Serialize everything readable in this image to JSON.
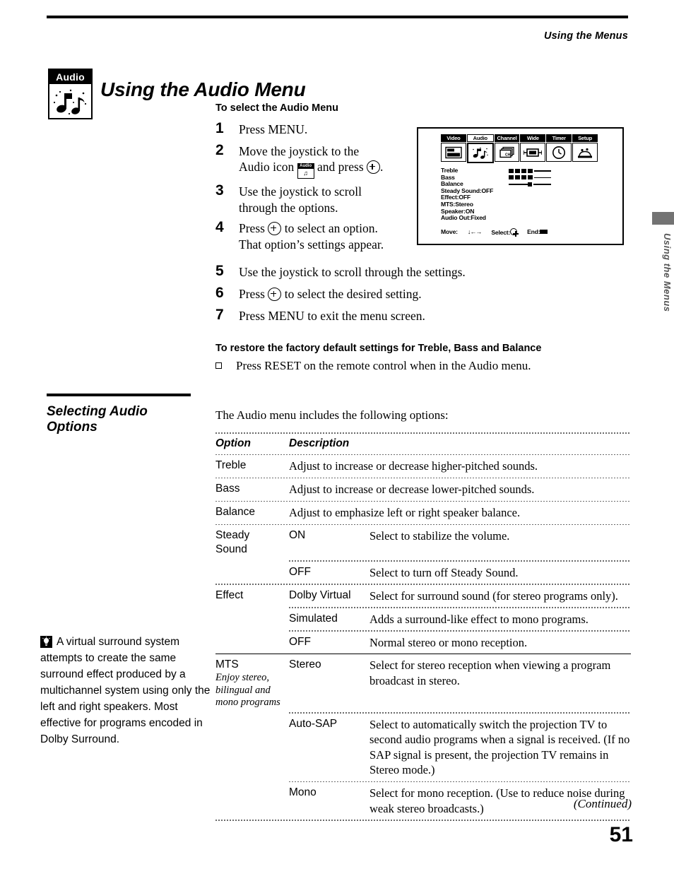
{
  "header": {
    "running_head": "Using the Menus"
  },
  "title": "Using the Audio Menu",
  "badge": {
    "label": "Audio",
    "icon": "music-notes-icon"
  },
  "select_section": {
    "heading": "To select the Audio Menu",
    "steps": [
      {
        "num": "1",
        "pre": "Press MENU.",
        "post": ""
      },
      {
        "num": "2",
        "pre": "Move the joystick to the",
        "line2_pre": "Audio icon",
        "line2_mid": "and press",
        "line2_post": "."
      },
      {
        "num": "3",
        "pre": "Use the joystick to scroll",
        "line2": "through the options."
      },
      {
        "num": "4",
        "pre": "Press",
        "mid": "to select an option.",
        "line2": "That option’s settings appear."
      },
      {
        "num": "5",
        "pre": "Use the joystick to scroll through the settings."
      },
      {
        "num": "6",
        "pre": "Press",
        "mid": "to select the desired setting."
      },
      {
        "num": "7",
        "pre": "Press MENU to exit the menu screen."
      }
    ]
  },
  "restore_section": {
    "heading": "To restore the factory default settings for Treble, Bass and Balance",
    "bullet": "Press RESET on the remote control when in the Audio menu."
  },
  "tv_menu": {
    "tabs": [
      {
        "label": "Video",
        "selected": false,
        "icon": "video-screen-icon"
      },
      {
        "label": "Audio",
        "selected": true,
        "icon": "music-notes-icon"
      },
      {
        "label": "Channel",
        "selected": false,
        "icon": "channel-cards-icon"
      },
      {
        "label": "Wide",
        "selected": false,
        "icon": "wide-screen-icon"
      },
      {
        "label": "Timer",
        "selected": false,
        "icon": "clock-icon"
      },
      {
        "label": "Setup",
        "selected": false,
        "icon": "setup-sofa-icon"
      }
    ],
    "items": [
      {
        "label": "Treble",
        "type": "bar",
        "value": 60
      },
      {
        "label": "Bass",
        "type": "bar",
        "value": 60
      },
      {
        "label": "Balance",
        "type": "centerbar",
        "value": 50
      },
      {
        "label": "Steady Sound:OFF",
        "type": "text"
      },
      {
        "label": "Effect:OFF",
        "type": "text"
      },
      {
        "label": "MTS:Stereo",
        "type": "text"
      },
      {
        "label": "Speaker:ON",
        "type": "text"
      },
      {
        "label": "Audio Out:Fixed",
        "type": "text"
      }
    ],
    "footer": {
      "move_label": "Move:",
      "move_arrows": "↓←→",
      "select_label": "Select:",
      "end_label": "End:"
    }
  },
  "side_tab": {
    "text": "Using the Menus"
  },
  "options_section": {
    "title_line1": "Selecting Audio",
    "title_line2": "Options",
    "lead": "The Audio menu includes the following options:",
    "columns": {
      "option": "Option",
      "description": "Description"
    },
    "rows": [
      {
        "option": "Treble",
        "note": "",
        "values": [
          {
            "value": "",
            "desc": "Adjust to increase or decrease higher-pitched sounds."
          }
        ]
      },
      {
        "option": "Bass",
        "note": "",
        "values": [
          {
            "value": "",
            "desc": "Adjust to increase or decrease lower-pitched sounds."
          }
        ]
      },
      {
        "option": "Balance",
        "note": "",
        "values": [
          {
            "value": "",
            "desc": "Adjust to emphasize left or right speaker balance."
          }
        ]
      },
      {
        "option": "Steady\nSound",
        "note": "",
        "values": [
          {
            "value": "ON",
            "desc": "Select to stabilize the volume."
          },
          {
            "value": "OFF",
            "desc": "Select to turn off Steady Sound."
          }
        ]
      },
      {
        "option": "Effect",
        "note": "",
        "values": [
          {
            "value": "Dolby Virtual",
            "desc": "Select for surround sound (for stereo programs only)."
          },
          {
            "value": "Simulated",
            "desc": "Adds a surround-like effect to mono programs."
          },
          {
            "value": "OFF",
            "desc": "Normal stereo or mono reception."
          }
        ]
      },
      {
        "option": "MTS",
        "note": "Enjoy stereo, bilingual and mono programs",
        "values": [
          {
            "value": "Stereo",
            "desc": "Select for stereo reception when viewing a program broadcast in stereo."
          },
          {
            "value": "Auto-SAP",
            "desc": "Select to automatically switch the projection TV to second audio programs when a signal is received. (If no SAP signal is present, the projection TV remains in Stereo mode.)"
          },
          {
            "value": "Mono",
            "desc": "Select for mono reception. (Use to reduce noise during weak stereo broadcasts.)"
          }
        ]
      }
    ]
  },
  "tip": {
    "icon": "lightbulb-tip-icon",
    "text": "A virtual surround system attempts to create the same surround effect produced by a multichannel system using only the left and right speakers. Most effective for programs encoded in Dolby Surround."
  },
  "footer": {
    "continued": "(Continued)",
    "page_number": "51"
  }
}
